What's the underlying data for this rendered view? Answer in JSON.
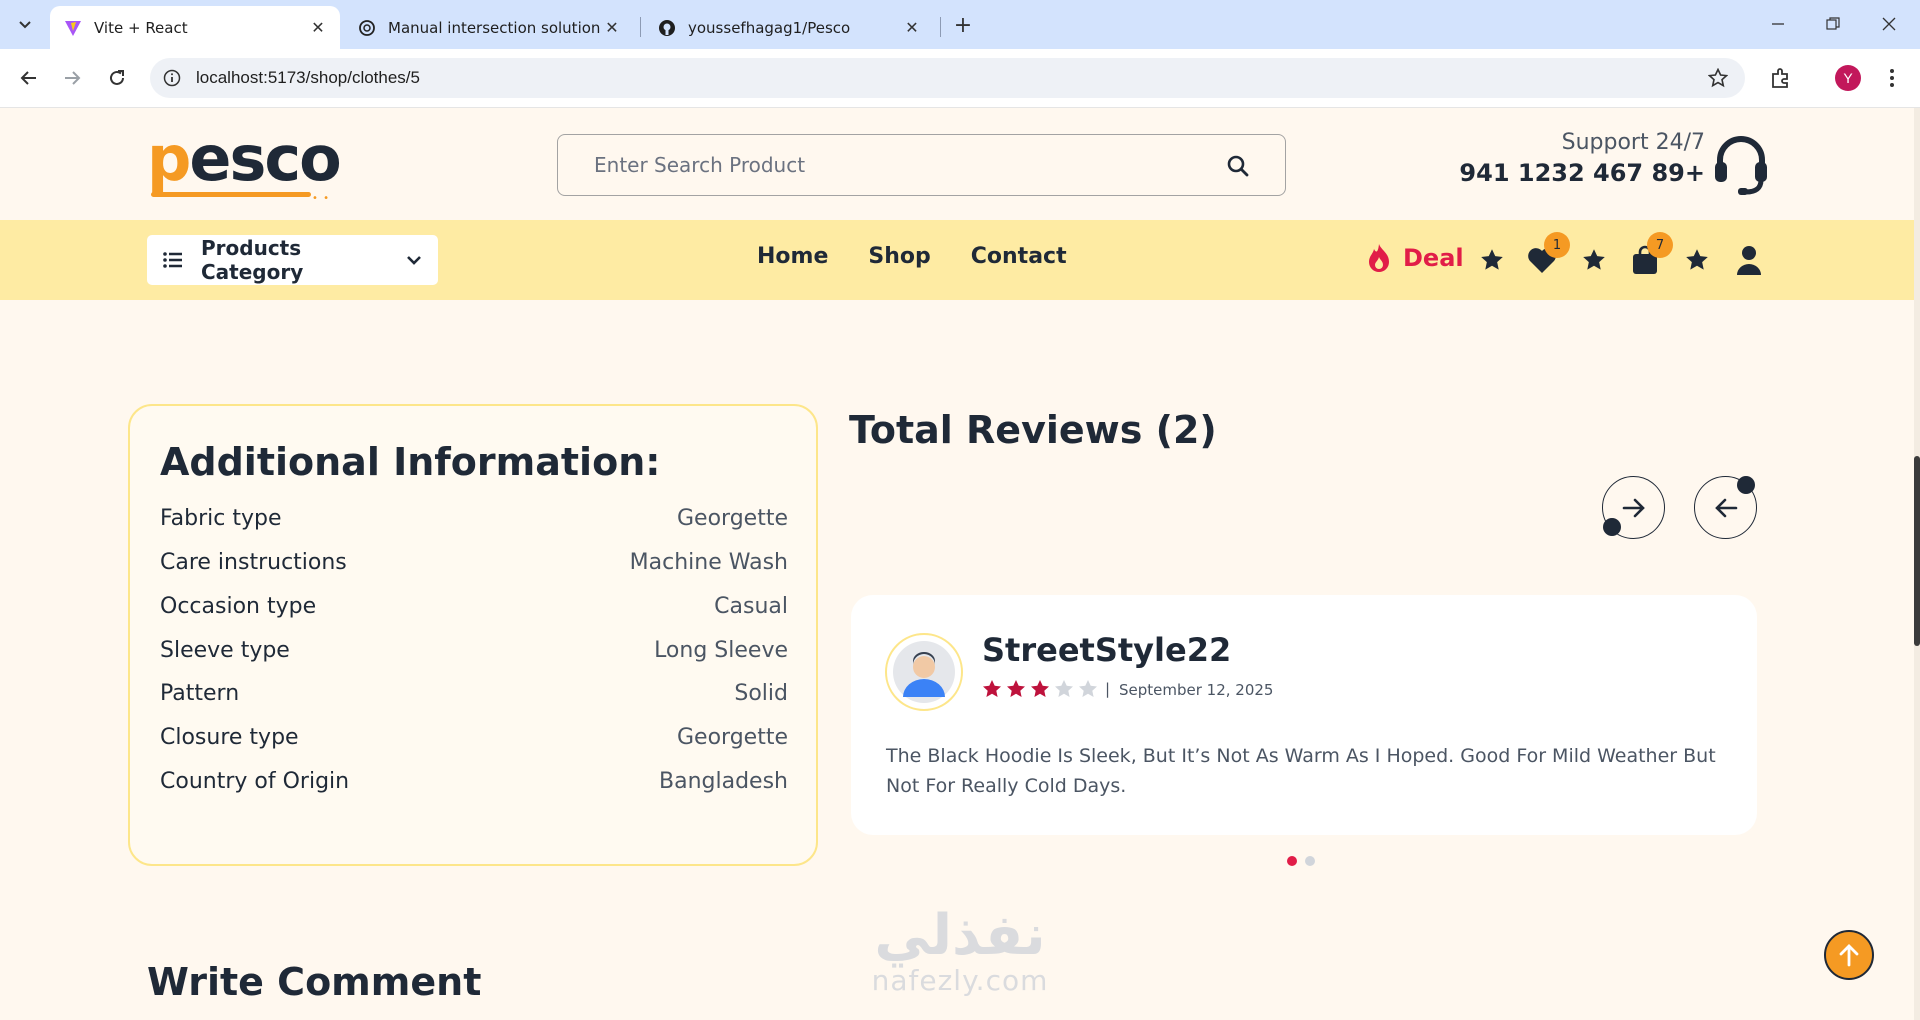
{
  "browser": {
    "tabs": [
      {
        "title": "Vite + React",
        "icon": "vite-icon",
        "active": true
      },
      {
        "title": "Manual intersection solution",
        "icon": "chatgpt-icon",
        "active": false
      },
      {
        "title": "youssefhagag1/Pesco",
        "icon": "github-icon",
        "active": false
      }
    ],
    "url": "localhost:5173/shop/clothes/5",
    "profile_initial": "Y"
  },
  "header": {
    "logo": {
      "first": "p",
      "rest": "esco",
      "dots": "• •"
    },
    "search_placeholder": "Enter Search Product",
    "support_label": "Support 24/7",
    "support_phone": "941 1232 467 89+"
  },
  "nav": {
    "category_label": "Products Category",
    "links": [
      "Home",
      "Shop",
      "Contact"
    ],
    "deal_label": "Deal",
    "wishlist_count": "1",
    "cart_count": "7"
  },
  "additional_info": {
    "title": "Additional Information:",
    "rows": [
      {
        "key": "Fabric type",
        "value": "Georgette"
      },
      {
        "key": "Care instructions",
        "value": "Machine Wash"
      },
      {
        "key": "Occasion type",
        "value": "Casual"
      },
      {
        "key": "Sleeve type",
        "value": "Long Sleeve"
      },
      {
        "key": "Pattern",
        "value": "Solid"
      },
      {
        "key": "Closure type",
        "value": "Georgette"
      },
      {
        "key": "Country of Origin",
        "value": "Bangladesh"
      }
    ]
  },
  "reviews": {
    "title": "Total Reviews (2)",
    "current": {
      "name": "StreetStyle22",
      "rating": 3,
      "max_rating": 5,
      "separator": "|",
      "date": "September 12, 2025",
      "text": "The Black Hoodie Is Sleek, But It’s Not As Warm As I Hoped. Good For Mild Weather But Not For Really Cold Days."
    },
    "pagination": {
      "total": 2,
      "active": 1
    }
  },
  "write_comment": {
    "title": "Write Comment"
  },
  "watermark": {
    "arabic": "نفذلي",
    "latin": "nafezly.com"
  },
  "colors": {
    "accent": "#f59a23",
    "deal_red": "#e11d48",
    "star_active": "#be123c",
    "star_inactive": "#d1d5db",
    "navbar_bg": "#feeba3",
    "page_bg": "#fff8ef"
  }
}
